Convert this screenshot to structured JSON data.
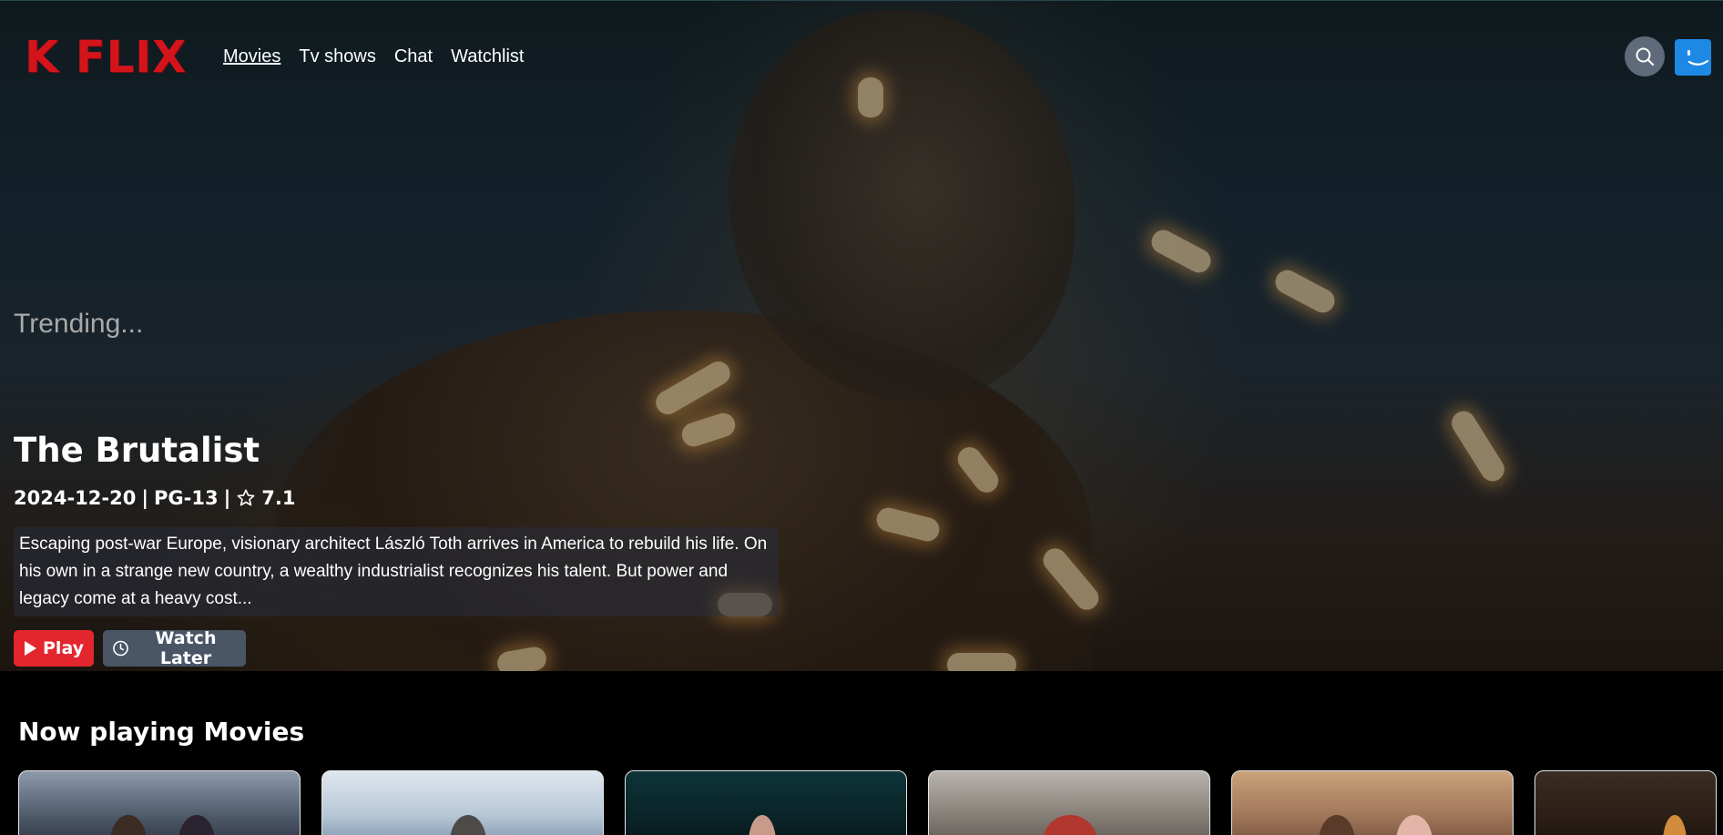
{
  "brand": {
    "logo_text": "K FLIX",
    "accent_color": "#d4141b"
  },
  "nav": {
    "links": [
      {
        "label": "Movies",
        "active": true
      },
      {
        "label": "Tv shows",
        "active": false
      },
      {
        "label": "Chat",
        "active": false
      },
      {
        "label": "Watchlist",
        "active": false
      }
    ],
    "search_icon": "search-icon",
    "avatar_icon": "smiley-avatar-icon"
  },
  "hero": {
    "section_label": "Trending...",
    "title": "The Brutalist",
    "release_date": "2024-12-20",
    "rating_label": "PG-13",
    "score": "7.1",
    "separator": "|",
    "description": "Escaping post-war Europe, visionary architect László Toth arrives in America to rebuild his life. On his own in a strange new country, a wealthy industrialist recognizes his talent. But power and legacy come at a heavy cost...",
    "play_label": "Play",
    "watch_later_label": "Watch Later",
    "play_color": "#e3262d"
  },
  "now_playing": {
    "title": "Now playing Movies"
  }
}
